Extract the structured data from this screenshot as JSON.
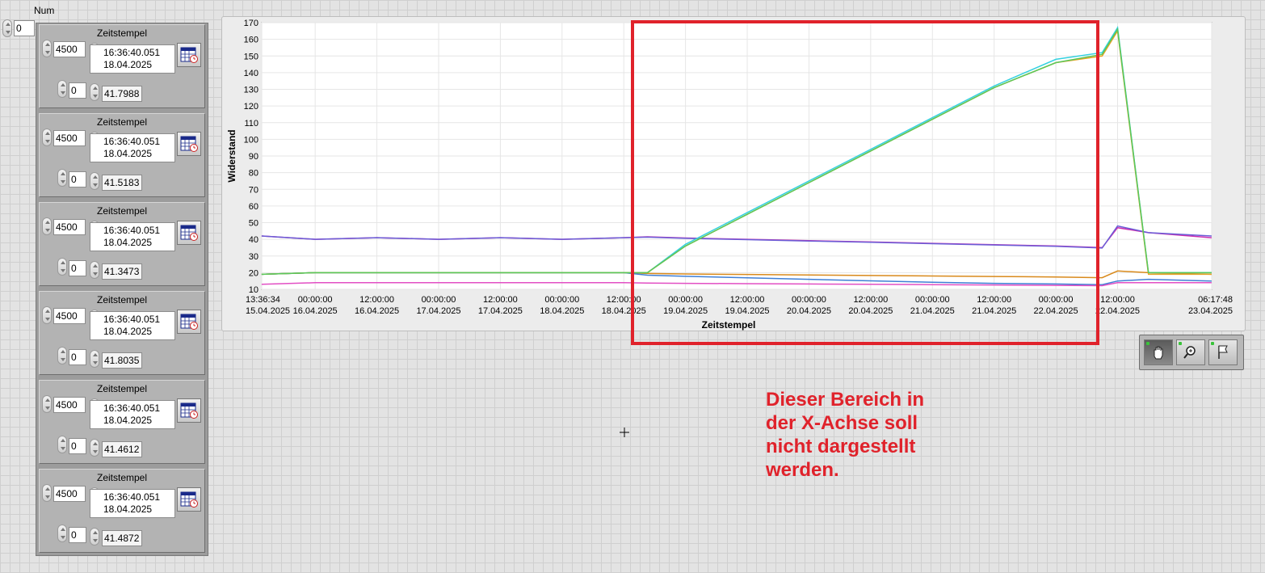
{
  "num_control": {
    "label": "Num",
    "value": "0"
  },
  "clusters": [
    {
      "title": "Zeitstempel",
      "count": "4500",
      "time": "16:36:40.051",
      "date": "18.04.2025",
      "index": "0",
      "value": "41.7988"
    },
    {
      "title": "Zeitstempel",
      "count": "4500",
      "time": "16:36:40.051",
      "date": "18.04.2025",
      "index": "0",
      "value": "41.5183"
    },
    {
      "title": "Zeitstempel",
      "count": "4500",
      "time": "16:36:40.051",
      "date": "18.04.2025",
      "index": "0",
      "value": "41.3473"
    },
    {
      "title": "Zeitstempel",
      "count": "4500",
      "time": "16:36:40.051",
      "date": "18.04.2025",
      "index": "0",
      "value": "41.8035"
    },
    {
      "title": "Zeitstempel",
      "count": "4500",
      "time": "16:36:40.051",
      "date": "18.04.2025",
      "index": "0",
      "value": "41.4612"
    },
    {
      "title": "Zeitstempel",
      "count": "4500",
      "time": "16:36:40.051",
      "date": "18.04.2025",
      "index": "0",
      "value": "41.4872"
    }
  ],
  "chart": {
    "xlabel": "Zeitstempel",
    "ylabel": "Widerstand",
    "y_ticks": [
      "10",
      "20",
      "30",
      "40",
      "50",
      "60",
      "70",
      "80",
      "90",
      "100",
      "110",
      "120",
      "130",
      "140",
      "150",
      "160",
      "170"
    ],
    "x_ticks": [
      {
        "time": "13:36:34",
        "date": "15.04.2025"
      },
      {
        "time": "00:00:00",
        "date": "16.04.2025"
      },
      {
        "time": "12:00:00",
        "date": "16.04.2025"
      },
      {
        "time": "00:00:00",
        "date": "17.04.2025"
      },
      {
        "time": "12:00:00",
        "date": "17.04.2025"
      },
      {
        "time": "00:00:00",
        "date": "18.04.2025"
      },
      {
        "time": "12:00:00",
        "date": "18.04.2025"
      },
      {
        "time": "00:00:00",
        "date": "19.04.2025"
      },
      {
        "time": "12:00:00",
        "date": "19.04.2025"
      },
      {
        "time": "00:00:00",
        "date": "20.04.2025"
      },
      {
        "time": "12:00:00",
        "date": "20.04.2025"
      },
      {
        "time": "00:00:00",
        "date": "21.04.2025"
      },
      {
        "time": "12:00:00",
        "date": "21.04.2025"
      },
      {
        "time": "00:00:00",
        "date": "22.04.2025"
      },
      {
        "time": "12:00:00",
        "date": "22.04.2025"
      },
      {
        "time": "06:17:48",
        "date": "23.04.2025"
      }
    ],
    "highlight_color": "#e0222b"
  },
  "chart_data": {
    "type": "line",
    "xlabel": "Zeitstempel",
    "ylabel": "Widerstand",
    "ylim": [
      10,
      170
    ],
    "xlim": [
      "2025-04-15 13:36:34",
      "2025-04-23 06:17:48"
    ],
    "grid": true,
    "x": [
      "2025-04-15 13:36",
      "2025-04-16 00:00",
      "2025-04-16 12:00",
      "2025-04-17 00:00",
      "2025-04-17 12:00",
      "2025-04-18 00:00",
      "2025-04-18 12:00",
      "2025-04-18 16:36",
      "2025-04-19 00:00",
      "2025-04-19 12:00",
      "2025-04-20 00:00",
      "2025-04-20 12:00",
      "2025-04-21 00:00",
      "2025-04-21 12:00",
      "2025-04-22 00:00",
      "2025-04-22 09:00",
      "2025-04-22 12:00",
      "2025-04-22 18:00",
      "2025-04-23 06:17"
    ],
    "series": [
      {
        "color": "#cc2fb0",
        "values": [
          42,
          40,
          41,
          40,
          41,
          40,
          41,
          41.5,
          40.8,
          40.0,
          39.2,
          38.4,
          37.6,
          36.8,
          36.0,
          35.0,
          47,
          44,
          41
        ]
      },
      {
        "color": "#6a5cd6",
        "values": [
          42,
          40,
          41,
          40,
          41,
          40,
          41,
          41.3,
          40.6,
          39.8,
          39.0,
          38.2,
          37.4,
          36.6,
          35.8,
          34.8,
          48,
          44,
          42
        ]
      },
      {
        "color": "#d98a1c",
        "values": [
          19,
          20,
          20,
          20,
          20,
          20,
          20,
          19.5,
          19.2,
          18.9,
          18.6,
          18.3,
          18.0,
          17.7,
          17.4,
          17.0,
          21,
          20,
          19
        ]
      },
      {
        "color": "#3f7fd6",
        "values": [
          19,
          20,
          20,
          20,
          20,
          20,
          20,
          18.5,
          17.8,
          16.9,
          16.0,
          15.1,
          14.2,
          13.6,
          13.2,
          12.8,
          15,
          16,
          15
        ]
      },
      {
        "color": "#e24fc4",
        "values": [
          13,
          14,
          14,
          14,
          14,
          14,
          14,
          13.8,
          13.6,
          13.4,
          13.2,
          13.0,
          12.8,
          12.6,
          12.4,
          12.2,
          14,
          14,
          14
        ]
      },
      {
        "color": "#33d1e0",
        "values": [
          19,
          20,
          20,
          20,
          20,
          20,
          20,
          20,
          37,
          56,
          75,
          94,
          113,
          132,
          148,
          152,
          167,
          20,
          20
        ]
      },
      {
        "color": "#e9a224",
        "values": [
          19,
          20,
          20,
          20,
          20,
          20,
          20,
          20,
          36,
          55,
          74,
          93,
          112,
          131,
          146,
          150,
          165,
          19,
          19
        ]
      },
      {
        "color": "#5ac85a",
        "values": [
          19,
          20,
          20,
          20,
          20,
          20,
          20,
          20,
          36,
          55,
          74,
          93,
          112,
          131,
          146,
          151,
          166,
          20,
          20
        ]
      }
    ]
  },
  "palette": {
    "buttons": [
      "pan-hand-icon",
      "zoom-icon",
      "flag-icon"
    ],
    "active": "pan-hand-icon"
  },
  "annotation": {
    "lines": [
      "Dieser Bereich in",
      "der X-Achse soll",
      "nicht dargestellt",
      "werden."
    ],
    "color": "#e0222b"
  }
}
